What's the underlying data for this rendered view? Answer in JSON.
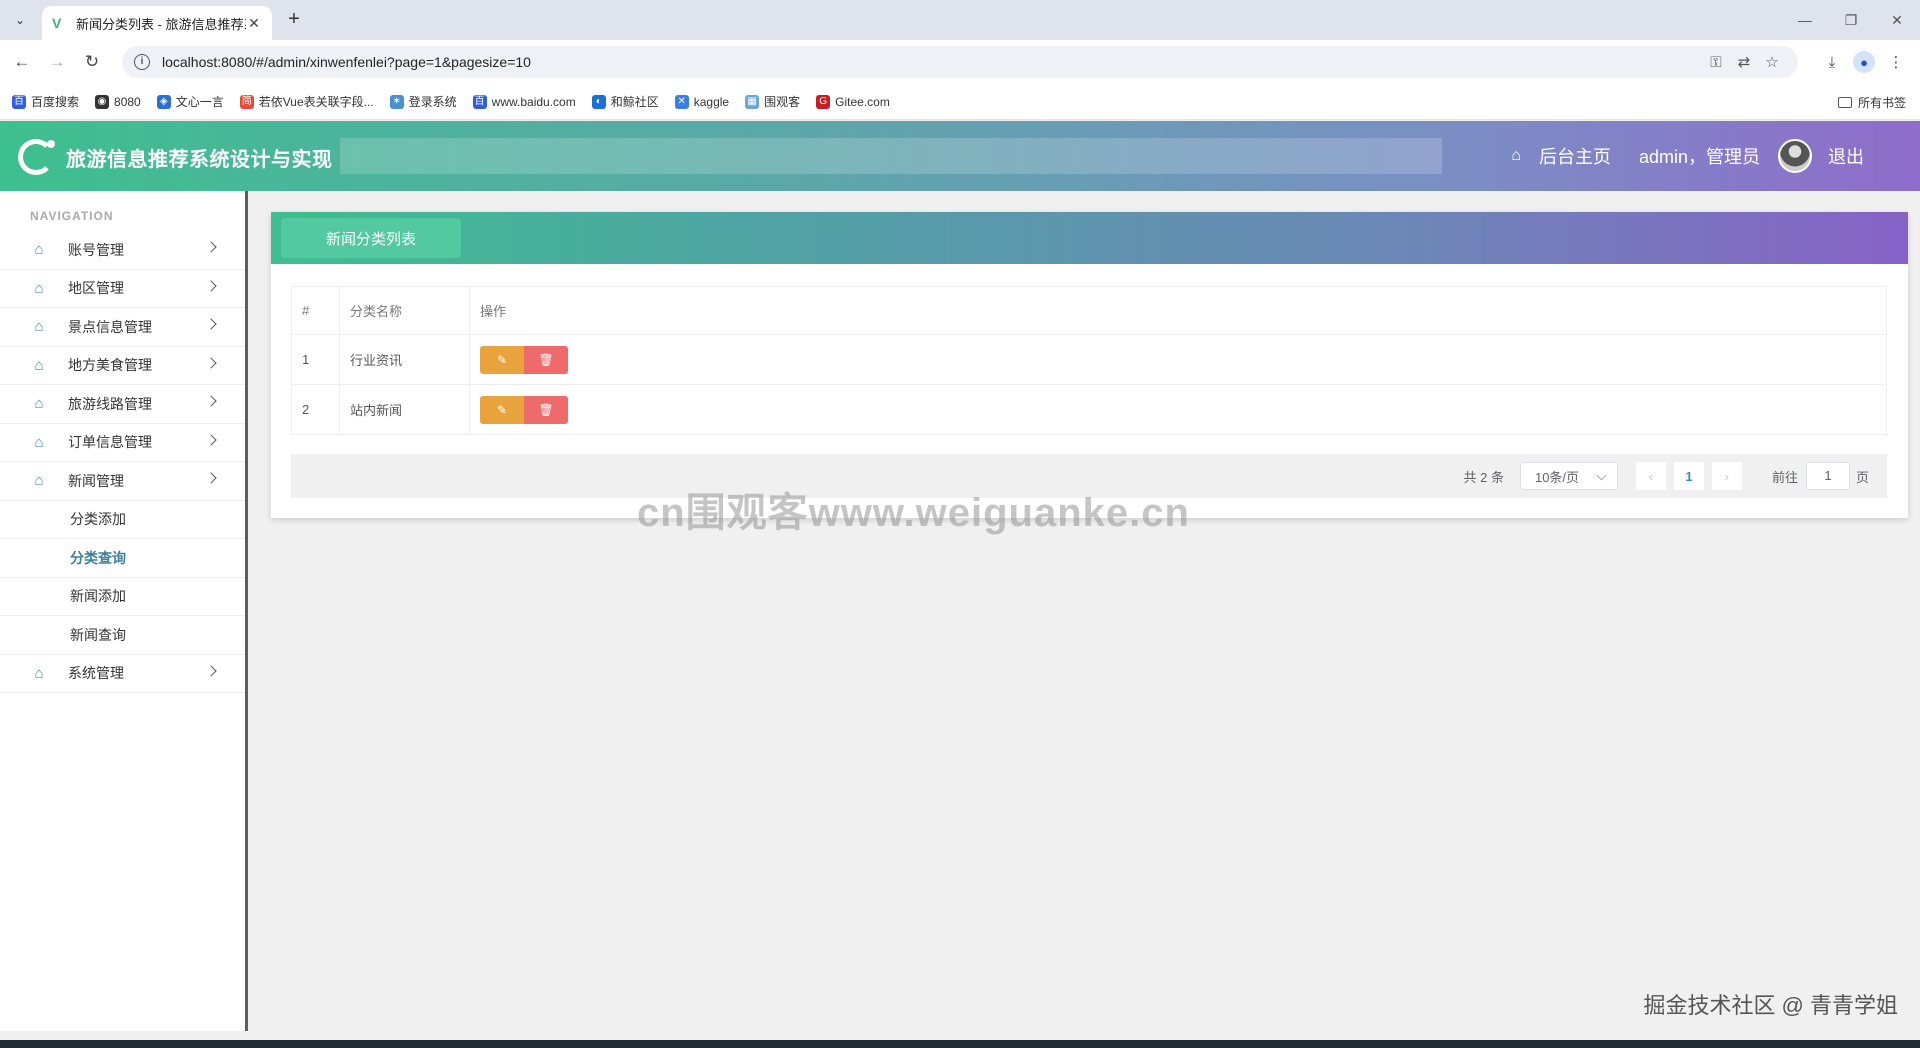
{
  "browser": {
    "tab_title": "新闻分类列表 - 旅游信息推荐系",
    "url": "localhost:8080/#/admin/xinwenfenlei?page=1&pagesize=10",
    "bookmarks": [
      {
        "label": "百度搜索",
        "color": "#2f5fde",
        "icon": "百"
      },
      {
        "label": "8080",
        "color": "#333333",
        "icon": "◉"
      },
      {
        "label": "文心一言",
        "color": "#2b6fd6",
        "icon": "◈"
      },
      {
        "label": "若依Vue表关联字段...",
        "color": "#e04f3a",
        "icon": "简"
      },
      {
        "label": "登录系统",
        "color": "#4a8fd0",
        "icon": "✶"
      },
      {
        "label": "www.baidu.com",
        "color": "#2f5fde",
        "icon": "百"
      },
      {
        "label": "和鲸社区",
        "color": "#1a6fd8",
        "icon": "◐"
      },
      {
        "label": "kaggle",
        "color": "#3c7ee0",
        "icon": "✕"
      },
      {
        "label": "围观客",
        "color": "#6aa7d8",
        "icon": "▦"
      },
      {
        "label": "Gitee.com",
        "color": "#c71d23",
        "icon": "G"
      }
    ],
    "all_bookmarks": "所有书签"
  },
  "header": {
    "app_title": "旅游信息推荐系统设计与实现",
    "home_link": "后台主页",
    "user": "admin，管理员",
    "logout": "退出"
  },
  "sidebar": {
    "caption": "NAVIGATION",
    "items": [
      {
        "label": "账号管理"
      },
      {
        "label": "地区管理"
      },
      {
        "label": "景点信息管理"
      },
      {
        "label": "地方美食管理"
      },
      {
        "label": "旅游线路管理"
      },
      {
        "label": "订单信息管理"
      },
      {
        "label": "新闻管理"
      }
    ],
    "sub_items": [
      {
        "label": "分类添加"
      },
      {
        "label": "分类查询"
      },
      {
        "label": "新闻添加"
      },
      {
        "label": "新闻查询"
      }
    ],
    "last_item": "系统管理"
  },
  "main": {
    "panel_title": "新闻分类列表",
    "columns": [
      "#",
      "分类名称",
      "操作"
    ],
    "rows": [
      {
        "index": "1",
        "name": "行业资讯"
      },
      {
        "index": "2",
        "name": "站内新闻"
      }
    ],
    "pagination": {
      "total": "共 2 条",
      "page_size": "10条/页",
      "current": "1",
      "goto_label": "前往",
      "goto_value": "1",
      "page_unit": "页"
    }
  },
  "watermark": "cn围观客www.weiguanke.cn",
  "corner_mark": "掘金技术社区 @ 青青学姐"
}
